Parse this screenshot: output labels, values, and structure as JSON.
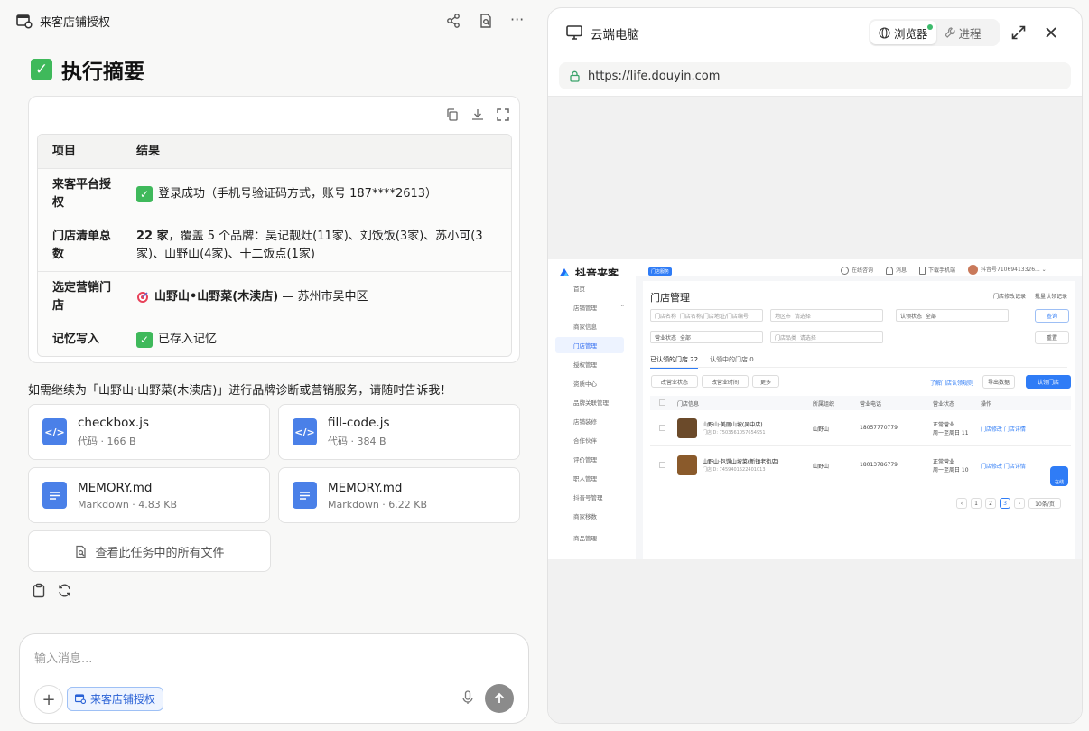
{
  "left": {
    "task_title": "来客店铺授权",
    "heading": "执行摘要",
    "table": {
      "headers": [
        "项目",
        "结果"
      ],
      "rows": [
        {
          "item": "来客平台授权",
          "result": "登录成功（手机号验证码方式，账号 187****2613）"
        },
        {
          "item": "门店清单总数",
          "result_bold": "22 家",
          "result_rest": "，覆盖 5 个品牌：吴记靓灶(11家)、刘饭饭(3家)、苏小可(3家)、山野山(4家)、十二饭点(1家)"
        },
        {
          "item": "选定营销门店",
          "result_bold": "山野山•山野菜(木渎店)",
          "result_rest": " — 苏州市吴中区"
        },
        {
          "item": "记忆写入",
          "result": "已存入记忆"
        }
      ]
    },
    "followup": "如需继续为「山野山·山野菜(木渎店)」进行品牌诊断或营销服务，请随时告诉我！",
    "files": [
      {
        "name": "checkbox.js",
        "meta": "代码 · 166 B",
        "icon": "code-file-icon"
      },
      {
        "name": "fill-code.js",
        "meta": "代码 · 384 B",
        "icon": "code-file-icon"
      },
      {
        "name": "MEMORY.md",
        "meta": "Markdown · 4.83 KB",
        "icon": "doc-file-icon"
      },
      {
        "name": "MEMORY.md",
        "meta": "Markdown · 6.22 KB",
        "icon": "doc-file-icon"
      }
    ],
    "view_all": "查看此任务中的所有文件",
    "composer": {
      "placeholder": "输入消息...",
      "chip": "来客店铺授权"
    }
  },
  "right": {
    "title": "云端电脑",
    "tabs": [
      "浏览器",
      "进程"
    ],
    "url": "https://life.douyin.com",
    "web": {
      "brand": "抖音来客",
      "badge": "门店服务",
      "top_links": [
        "在线咨询",
        "消息",
        "下载手机端",
        "抖音号71069413326..."
      ],
      "nav": [
        "首页",
        "店铺管理",
        "商家信息",
        "门店管理",
        "授权管理",
        "资质中心",
        "品牌关联管理",
        "店铺装修",
        "合作伙伴",
        "评价管理",
        "职人管理",
        "抖音号管理",
        "商家移数",
        "商品管理"
      ],
      "page_title": "门店管理",
      "page_actions": [
        "门店修改记录",
        "批量认领记录"
      ],
      "filters": {
        "store_name": "门店名称",
        "store_ph": "门店名称/门店地址/门店编号",
        "region": "地区市",
        "region_ph": "请选择",
        "claim": "认领状态",
        "claim_val": "全部",
        "biz": "营业状态",
        "biz_val": "全部",
        "category": "门店品类",
        "category_ph": "请选择",
        "search": "查询",
        "reset": "重置"
      },
      "tabs": [
        "已认领的门店 22",
        "认领中的门店 0"
      ],
      "actions": [
        "改营业状态",
        "改营业时间",
        "更多"
      ],
      "right_actions": [
        "了解门店认领规则",
        "导出数据",
        "认领门店"
      ],
      "columns": [
        "门店信息",
        "所属组织",
        "营业电话",
        "营业状态",
        "操作"
      ],
      "rows": [
        {
          "name": "山野山·美丽山坡(吴中店)",
          "id": "门店ID: 7503561057654951",
          "org": "山野山",
          "phone": "18057770779",
          "status": "正常营业",
          "hours": "周一至周日 11",
          "ops": "门店修改  门店详情"
        },
        {
          "name": "山野山·包馔山坡菜(新镇老街店)",
          "id": "门店ID: 7459401522401013",
          "org": "山野山",
          "phone": "18013786779",
          "status": "正常营业",
          "hours": "周一至周日 10",
          "ops": "门店修改  门店详情"
        }
      ],
      "pager": [
        "1",
        "2",
        "3",
        "10条/页"
      ],
      "mascot": "在线"
    }
  }
}
